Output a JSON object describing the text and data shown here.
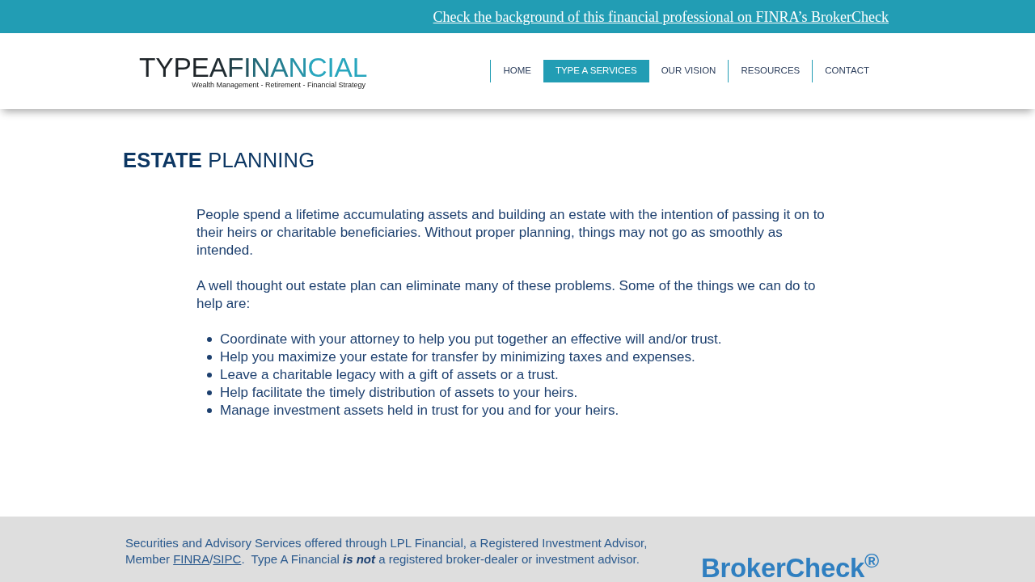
{
  "top_bar": {
    "link": "Check the background of this financial professional on FINRA’s BrokerCheck"
  },
  "header": {
    "logo": {
      "wordmark": "TYPEAFINANCIAL",
      "tagline": "Wealth Management - Retirement - Financial Strategy"
    },
    "nav": [
      {
        "label": "HOME",
        "selected": false
      },
      {
        "label": "TYPE A SERVICES",
        "selected": true
      },
      {
        "label": "OUR VISION",
        "selected": false
      },
      {
        "label": "RESOURCES",
        "selected": false
      },
      {
        "label": "CONTACT",
        "selected": false
      }
    ]
  },
  "main": {
    "heading": "**ESTATE** PLANNING",
    "paragraphs": [
      "People spend a lifetime accumulating assets and building an estate with the intention of passing it on to their heirs or charitable beneficiaries. Without proper planning, things may not go as smoothly as intended.",
      "A well thought out estate plan can eliminate many of these problems. Some of the things we can do to help are:"
    ],
    "bullets": [
      "Coordinate with your attorney to help you put together an effective will and/or trust.",
      "Help you maximize your estate for transfer by minimizing taxes and expenses.",
      "Leave a charitable legacy with a gift of assets or a trust.",
      "Help facilitate the timely distribution of assets to your heirs.",
      "Manage investment assets held in trust for you and for your heirs."
    ]
  },
  "footer": {
    "disclaimer": [
      {
        "kind": "text",
        "text": "Securities and Advisory Services offered through LPL Financial, a Registered Investment Advisor, Member "
      },
      {
        "kind": "link",
        "text": "FINRA"
      },
      {
        "kind": "text",
        "text": "/"
      },
      {
        "kind": "link",
        "text": "SIPC"
      },
      {
        "kind": "text",
        "text": ".  Type A Financial "
      },
      {
        "kind": "emphasis",
        "text": "is not"
      },
      {
        "kind": "text",
        "text": " a registered broker-dealer or investment advisor."
      }
    ],
    "badge": "BrokerCheck$^{®}$"
  }
}
